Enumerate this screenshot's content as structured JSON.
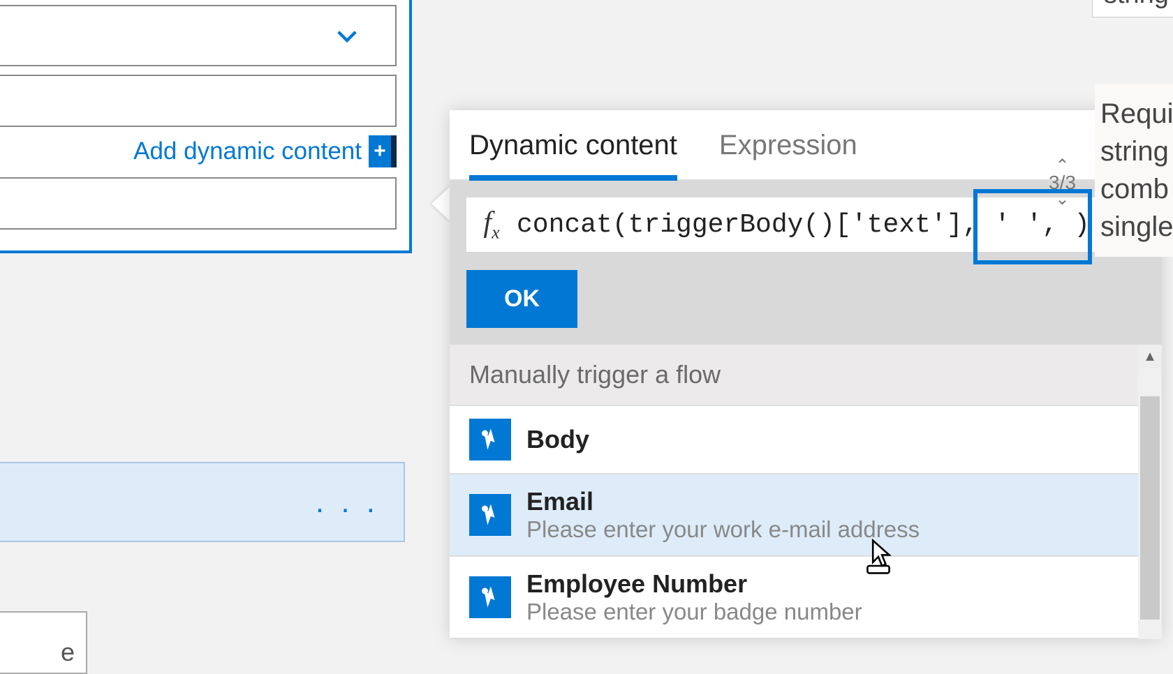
{
  "leftPanel": {
    "addDynamic": "Add dynamic content",
    "plusLabel": "+"
  },
  "lowerCard": {
    "more": ". . ."
  },
  "bottomBox": {
    "txt": "e"
  },
  "popup": {
    "tabs": {
      "dynamic": "Dynamic content",
      "expression": "Expression"
    },
    "fxLabel": "fx",
    "expression": "concat(triggerBody()['text'], ' ', )",
    "okLabel": "OK",
    "sectionHeader": "Manually trigger a flow",
    "items": [
      {
        "title": "Body",
        "desc": ""
      },
      {
        "title": "Email",
        "desc": "Please enter your work e-mail address"
      },
      {
        "title": "Employee Number",
        "desc": "Please enter your badge number"
      }
    ]
  },
  "tooltip": {
    "top": "string",
    "counter": "3/3",
    "body1": "Requi",
    "body2": "string",
    "body3": "comb",
    "body4": "single"
  }
}
